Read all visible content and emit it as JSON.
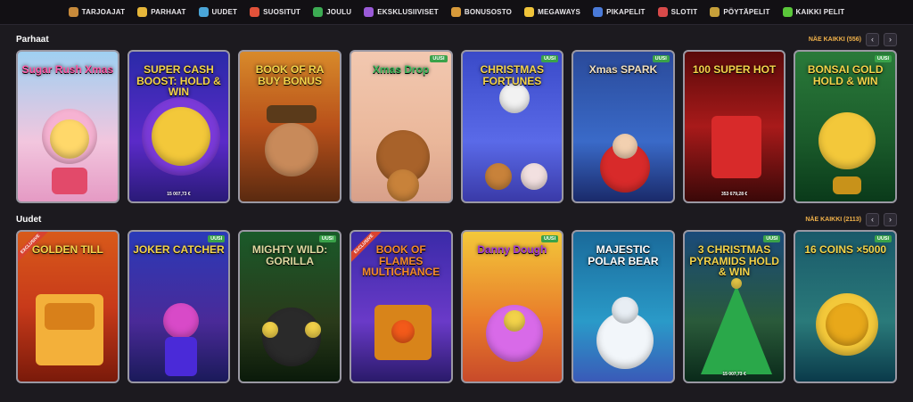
{
  "nav": [
    {
      "label": "TARJOAJAT",
      "icon": "chest-icon",
      "color": "#c78a3b"
    },
    {
      "label": "PARHAAT",
      "icon": "star-icon",
      "color": "#e6b63a"
    },
    {
      "label": "UUDET",
      "icon": "sparkle-icon",
      "color": "#4aa5d8"
    },
    {
      "label": "SUOSITUT",
      "icon": "flame-icon",
      "color": "#e2523a"
    },
    {
      "label": "JOULU",
      "icon": "tree-icon",
      "color": "#3cab53"
    },
    {
      "label": "EKSKLUSIIVISET",
      "icon": "gem-icon",
      "color": "#9a5ad8"
    },
    {
      "label": "BONUSOSTO",
      "icon": "coin-bag-icon",
      "color": "#d89a3a"
    },
    {
      "label": "MEGAWAYS",
      "icon": "lightning-icon",
      "color": "#f0c43a"
    },
    {
      "label": "PIKAPELIT",
      "icon": "joystick-icon",
      "color": "#4a7ad8"
    },
    {
      "label": "SLOTIT",
      "icon": "slot-machine-icon",
      "color": "#d84a4a"
    },
    {
      "label": "PÖYTÄPELIT",
      "icon": "cards-icon",
      "color": "#c7a03a"
    },
    {
      "label": "KAIKKI PELIT",
      "icon": "grid-icon",
      "color": "#5ac73a"
    }
  ],
  "sections": [
    {
      "title": "Parhaat",
      "see_all": "NÄE KAIKKI (556)",
      "tiles": [
        {
          "title": "Sugar Rush Xmas",
          "badge": "",
          "bg": "linear-gradient(180deg,#9fd0f2,#f2c6de 60%,#e59ac4)",
          "color": "#ff5aa8",
          "jackpot": "",
          "art": "gumball"
        },
        {
          "title": "SUPER CASH BOOST: HOLD & WIN",
          "badge": "",
          "bg": "linear-gradient(180deg,#2a2aa8,#5a2ac8 60%,#2a1a78)",
          "color": "#f3d34a",
          "jackpot": "15 007,73 €",
          "art": "bolt"
        },
        {
          "title": "BOOK OF RA BUY BONUS",
          "badge": "",
          "bg": "linear-gradient(180deg,#d88a2a,#b8501a 50%,#5a2a10)",
          "color": "#f3d34a",
          "jackpot": "",
          "art": "man"
        },
        {
          "title": "Xmas Drop",
          "badge": "UUSI",
          "bg": "linear-gradient(180deg,#f2c8b0,#eab79a 60%,#d8a08a)",
          "color": "#3ab85a",
          "jackpot": "",
          "art": "bear"
        },
        {
          "title": "CHRISTMAS FORTUNES",
          "badge": "UUSI",
          "bg": "linear-gradient(180deg,#3a4ac8,#5a6ae8 60%,#3a3aa8)",
          "color": "#f3d34a",
          "jackpot": "",
          "art": "snowman"
        },
        {
          "title": "Xmas SPARK",
          "badge": "UUSI",
          "bg": "linear-gradient(180deg,#2a4a9a,#3a6ac8 60%,#1a2a6a)",
          "color": "#f0e0c0",
          "jackpot": "",
          "art": "santa"
        },
        {
          "title": "100 SUPER HOT",
          "badge": "",
          "bg": "linear-gradient(180deg,#5a0a0a,#a81a1a 50%,#3a0808)",
          "color": "#f3d34a",
          "jackpot": "353 679,28 €",
          "art": "seven"
        },
        {
          "title": "BONSAI GOLD HOLD & WIN",
          "badge": "UUSI",
          "bg": "linear-gradient(180deg,#2a7a3a,#1a5a2a 60%,#0a3a1a)",
          "color": "#f3d34a",
          "jackpot": "",
          "art": "tree"
        }
      ]
    },
    {
      "title": "Uudet",
      "see_all": "NÄE KAIKKI (2113)",
      "tiles": [
        {
          "title": "GOLDEN TILL",
          "badge": "",
          "excl": "EXCLUSIVE",
          "bg": "linear-gradient(180deg,#d85a1a,#c83a1a 50%,#7a1a0a)",
          "color": "#f3d34a",
          "jackpot": "",
          "art": "chest"
        },
        {
          "title": "JOKER CATCHER",
          "badge": "UUSI",
          "bg": "linear-gradient(180deg,#2a3ab8,#4a2a98 60%,#1a1a5a)",
          "color": "#f3d34a",
          "jackpot": "",
          "art": "joker"
        },
        {
          "title": "MIGHTY WILD: GORILLA",
          "badge": "UUSI",
          "bg": "linear-gradient(180deg,#1a5a2a,#2a3a1a 60%,#0a1a0a)",
          "color": "#e0d8a0",
          "jackpot": "",
          "art": "gorilla"
        },
        {
          "title": "BOOK OF FLAMES MULTICHANCE",
          "badge": "",
          "excl": "EXCLUSIVE",
          "bg": "linear-gradient(180deg,#3a2aa8,#6a3ac8 60%,#2a1a6a)",
          "color": "#f38a2a",
          "jackpot": "",
          "art": "book"
        },
        {
          "title": "Danny Dough",
          "badge": "UUSI",
          "bg": "linear-gradient(180deg,#f3c83a,#e87a2a 60%,#c84a2a)",
          "color": "#a83ad8",
          "jackpot": "",
          "art": "dough"
        },
        {
          "title": "MAJESTIC POLAR BEAR",
          "badge": "",
          "bg": "linear-gradient(180deg,#1a6a9a,#2a9ac8 60%,#3a5ab8)",
          "color": "#ffffff",
          "jackpot": "",
          "art": "polar"
        },
        {
          "title": "3 CHRISTMAS PYRAMIDS HOLD & WIN",
          "badge": "UUSI",
          "bg": "linear-gradient(180deg,#1a4a7a,#2a5a3a 60%,#0a2a1a)",
          "color": "#f3d34a",
          "jackpot": "15 007,73 €",
          "art": "pyramid"
        },
        {
          "title": "16 COINS ×5000",
          "badge": "UUSI",
          "bg": "linear-gradient(180deg,#1a5a6a,#2a7a7a 60%,#0a3a4a)",
          "color": "#f3d34a",
          "jackpot": "",
          "art": "coin"
        }
      ]
    }
  ]
}
